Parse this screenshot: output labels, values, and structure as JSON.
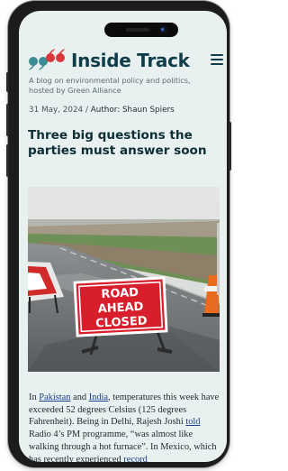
{
  "site": {
    "title": "Inside Track",
    "tagline": "A blog on environmental policy and politics, hosted by Green Alliance"
  },
  "post": {
    "date": "31 May, 2024",
    "separator": " / ",
    "author_label": "Author: Shaun Spiers",
    "headline": "Three big questions the parties must answer soon",
    "image": {
      "sign_line1": "ROAD",
      "sign_line2": "AHEAD",
      "sign_line3": "CLOSED"
    },
    "body": {
      "p1_start": "In ",
      "link_pakistan": "Pakistan",
      "p1_and": " and ",
      "link_india": "India",
      "p1_mid": ", temperatures this week have exceeded 52 degrees Celsius (125 degrees Fahrenheit). Being in Delhi, Rajesh Joshi ",
      "link_told": "told",
      "p1_mid2": " Radio 4’s PM programme, “was almost like walking through a hot furnace”. In Mexico, which has recently experienced ",
      "link_record": "record"
    }
  },
  "colors": {
    "brand_dark": "#0f3d4a",
    "quote_teal": "#3c8d93",
    "quote_red": "#d9363e",
    "screen_bg": "#e8f1ef",
    "link": "#1a3f8c"
  },
  "icons": [
    "quote-logo-icon",
    "hamburger-menu-icon"
  ]
}
